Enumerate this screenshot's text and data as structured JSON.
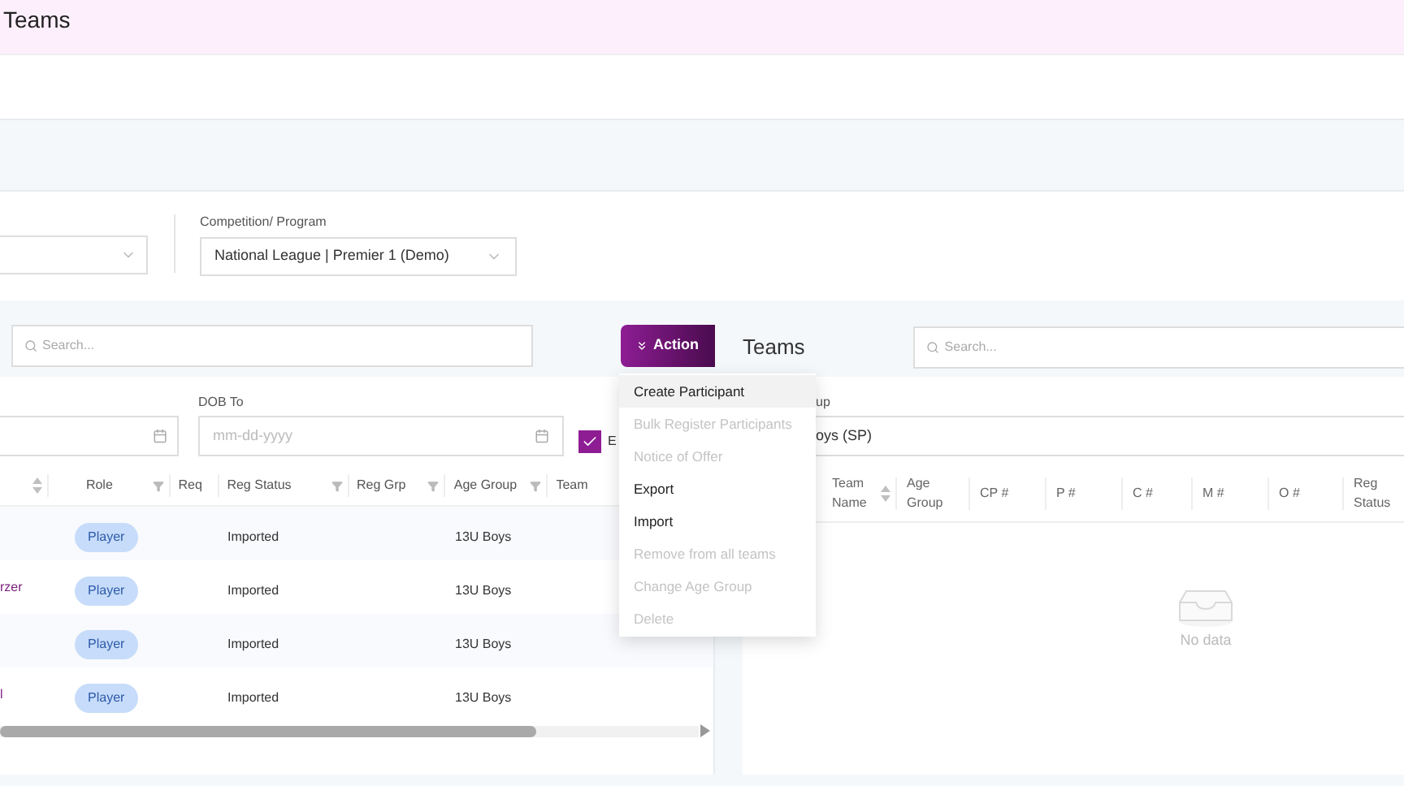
{
  "header": {
    "title": "Teams"
  },
  "filters": {
    "competition": {
      "label": "Competition/ Program",
      "value": "National League | Premier 1 (Demo)"
    }
  },
  "left_panel": {
    "search": {
      "placeholder": "Search..."
    },
    "action_button": {
      "label": "Action"
    },
    "dob_to": {
      "label": "DOB To",
      "placeholder": "mm-dd-yyyy"
    },
    "checkbox": {
      "label": "E",
      "checked": true
    },
    "columns": [
      {
        "kind": "sort"
      },
      {
        "label": "Role",
        "kind": "filter"
      },
      {
        "label": "Req",
        "kind": "plain"
      },
      {
        "label": "Reg Status",
        "kind": "filter"
      },
      {
        "label": "Reg Grp",
        "kind": "filter"
      },
      {
        "label": "Age Group",
        "kind": "filter"
      },
      {
        "label": "Team",
        "kind": "plain"
      }
    ],
    "rows": [
      {
        "role": "Player",
        "reg_status": "Imported",
        "age_group": "13U Boys"
      },
      {
        "name": "rzer",
        "role": "Player",
        "reg_status": "Imported",
        "age_group": "13U Boys"
      },
      {
        "role": "Player",
        "reg_status": "Imported",
        "age_group": "13U Boys"
      },
      {
        "name": "l",
        "role": "Player",
        "reg_status": "Imported",
        "age_group": "13U Boys"
      }
    ]
  },
  "action_menu": [
    {
      "label": "Create Participant",
      "disabled": false,
      "selected": true
    },
    {
      "label": "Bulk Register Participants",
      "disabled": true,
      "selected": false
    },
    {
      "label": "Notice of Offer",
      "disabled": true,
      "selected": false
    },
    {
      "label": "Export",
      "disabled": false,
      "selected": false
    },
    {
      "label": "Import",
      "disabled": false,
      "selected": false
    },
    {
      "label": "Remove from all teams",
      "disabled": true,
      "selected": false
    },
    {
      "label": "Change Age Group",
      "disabled": true,
      "selected": false
    },
    {
      "label": "Delete",
      "disabled": true,
      "selected": false
    }
  ],
  "right_panel": {
    "title": "Teams",
    "search": {
      "placeholder": "Search..."
    },
    "age_group": {
      "label": "up",
      "value": "oys (SP)"
    },
    "columns": [
      {
        "label": "Team Name",
        "kind": "sort"
      },
      {
        "label": "Age Group",
        "kind": "plain"
      },
      {
        "label": "CP #",
        "kind": "plain"
      },
      {
        "label": "P #",
        "kind": "plain"
      },
      {
        "label": "C #",
        "kind": "plain"
      },
      {
        "label": "M #",
        "kind": "plain"
      },
      {
        "label": "O #",
        "kind": "plain"
      },
      {
        "label": "Reg Status",
        "kind": "plain"
      }
    ],
    "empty_text": "No data"
  }
}
